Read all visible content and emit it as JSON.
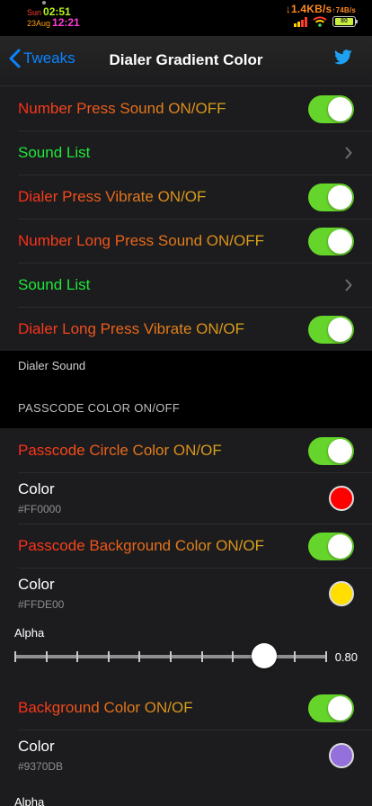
{
  "status_bar": {
    "day": "Sun",
    "time": "02:51",
    "date": "23Aug",
    "time2": "12:21",
    "speed_down": "↓1.4KB/s",
    "speed_up": "↑74B/s",
    "battery": "80",
    "colors": {
      "day": "#ff3b30",
      "time": "#b5f51d",
      "date": "#ff9f0a",
      "time2": "#ff3bd7",
      "speed": "#ff8a1e"
    }
  },
  "nav": {
    "back_label": "Tweaks",
    "title": "Dialer Gradient Color",
    "right_icon": "twitter-bird-icon"
  },
  "dialer_group": {
    "rows": [
      {
        "label": "Number Press Sound ON/OFF",
        "type": "toggle",
        "on": true
      },
      {
        "label": "Sound List",
        "type": "link"
      },
      {
        "label": "Dialer Press Vibrate ON/OF",
        "type": "toggle",
        "on": true
      },
      {
        "label": "Number Long Press Sound ON/OFF",
        "type": "toggle",
        "on": true
      },
      {
        "label": "Sound List",
        "type": "link"
      },
      {
        "label": "Dialer Long Press Vibrate ON/OF",
        "type": "toggle",
        "on": true
      }
    ],
    "footer": "Dialer Sound"
  },
  "passcode_header": "PASSCODE COLOR ON/OFF",
  "passcode_group": {
    "circle_toggle_label": "Passcode Circle Color ON/OF",
    "circle_color": {
      "label": "Color",
      "value": "#FF0000",
      "swatch": "#ff0000"
    },
    "bg_toggle_label": "Passcode Background Color ON/OF",
    "bg_color": {
      "label": "Color",
      "value": "#FFDE00",
      "swatch": "#ffde00"
    },
    "alpha": {
      "label": "Alpha",
      "value": "0.80",
      "fraction": 0.8
    },
    "background_toggle_label": "Background Color ON/OF",
    "background_color": {
      "label": "Color",
      "value": "#9370DB",
      "swatch": "#9370db"
    },
    "alpha2": {
      "label": "Alpha"
    }
  },
  "accent": {
    "toggle_on": "#66d52b",
    "link": "#0a84ff",
    "label_red": "#f23a1d",
    "label_green": "#1ee83a"
  }
}
